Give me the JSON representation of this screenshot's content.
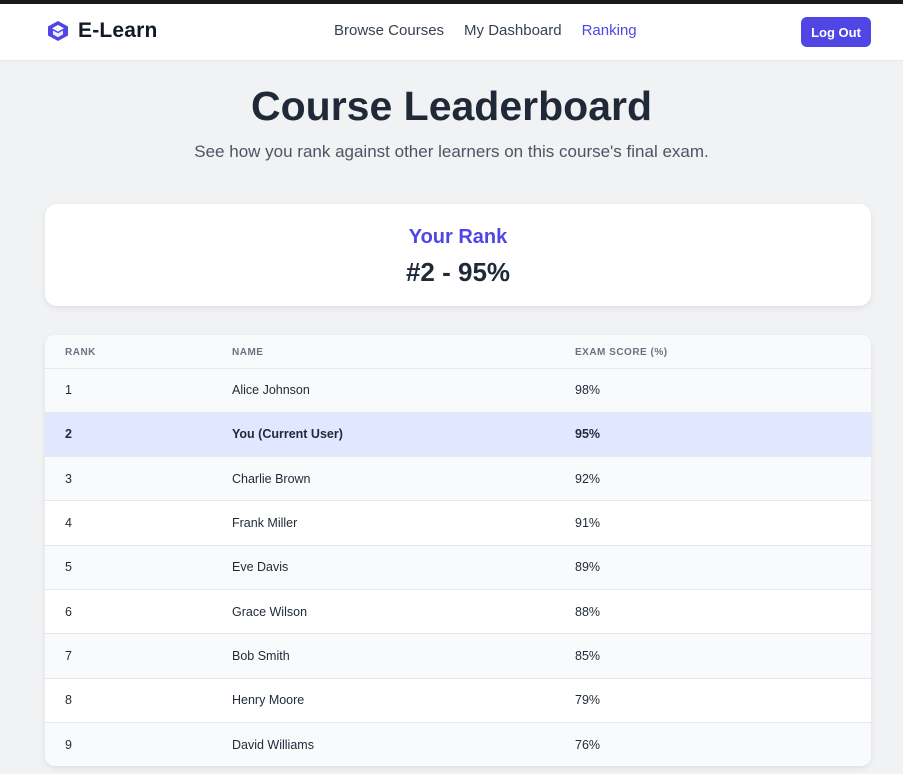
{
  "brand": {
    "name": "E-Learn",
    "icon": "graduation-cap-icon",
    "accent": "#4f46e5"
  },
  "nav": {
    "links": [
      {
        "label": "Browse Courses",
        "active": false
      },
      {
        "label": "My Dashboard",
        "active": false
      },
      {
        "label": "Ranking",
        "active": true
      }
    ],
    "logout_label": "Log Out"
  },
  "header": {
    "title": "Course Leaderboard",
    "subtitle": "See how you rank against other learners on this course's final exam."
  },
  "your_rank": {
    "label": "Your Rank",
    "value": "#2 - 95%"
  },
  "table": {
    "columns": [
      "RANK",
      "NAME",
      "EXAM SCORE (%)"
    ],
    "rows": [
      {
        "rank": "1",
        "name": "Alice Johnson",
        "score": "98%"
      },
      {
        "rank": "2",
        "name": "You (Current User)",
        "score": "95%",
        "current": true
      },
      {
        "rank": "3",
        "name": "Charlie Brown",
        "score": "92%"
      },
      {
        "rank": "4",
        "name": "Frank Miller",
        "score": "91%"
      },
      {
        "rank": "5",
        "name": "Eve Davis",
        "score": "89%"
      },
      {
        "rank": "6",
        "name": "Grace Wilson",
        "score": "88%"
      },
      {
        "rank": "7",
        "name": "Bob Smith",
        "score": "85%"
      },
      {
        "rank": "8",
        "name": "Henry Moore",
        "score": "79%"
      },
      {
        "rank": "9",
        "name": "David Williams",
        "score": "76%"
      }
    ]
  }
}
